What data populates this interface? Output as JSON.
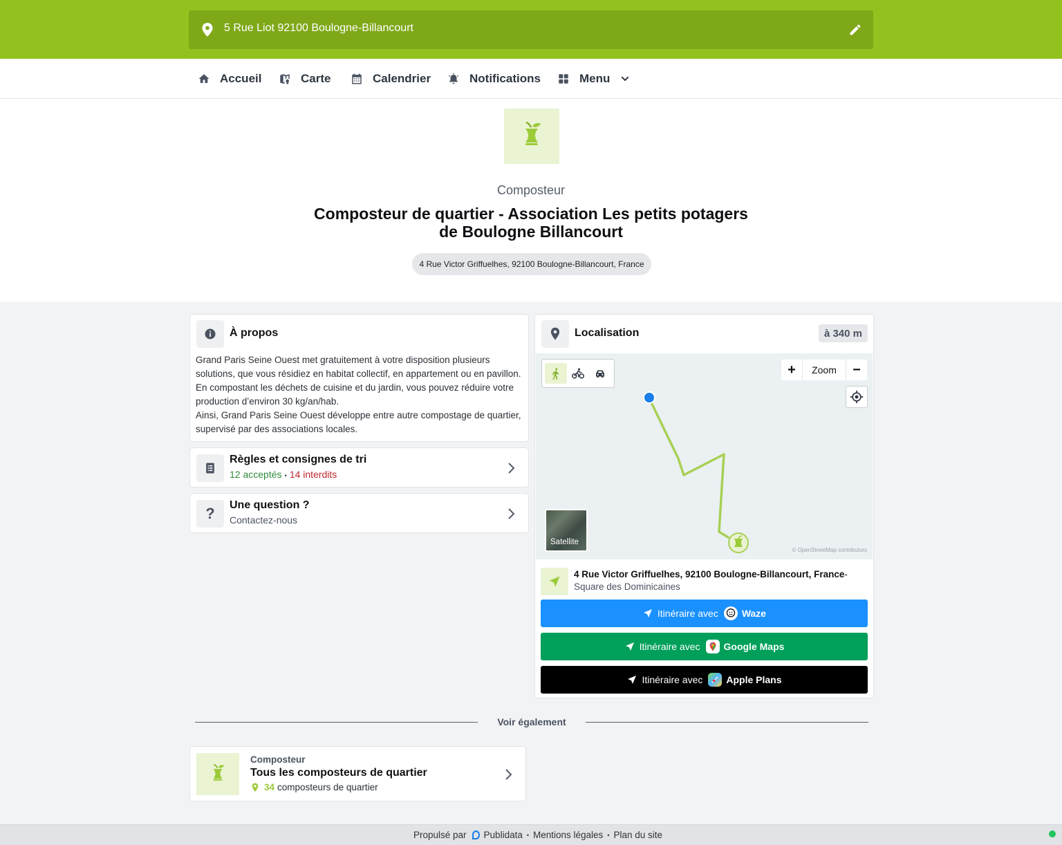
{
  "header": {
    "address": "5 Rue Liot 92100 Boulogne-Billancourt"
  },
  "nav": {
    "items": [
      {
        "label": "Accueil",
        "icon": "home-icon"
      },
      {
        "label": "Carte",
        "icon": "map-icon"
      },
      {
        "label": "Calendrier",
        "icon": "calendar-icon"
      },
      {
        "label": "Notifications",
        "icon": "bell-icon"
      },
      {
        "label": "Menu",
        "icon": "grid-icon"
      }
    ]
  },
  "hero": {
    "category": "Composteur",
    "title": "Composteur de quartier - Association Les petits potagers de Boulogne Billancourt",
    "address": "4 Rue Victor Griffuelhes, 92100 Boulogne-Billancourt, France"
  },
  "about": {
    "title": "À propos",
    "text_1": "Grand Paris Seine Ouest met gratuitement à votre disposition plusieurs solutions, que vous résidiez en habitat collectif, en appartement ou en pavillon. En compostant les déchets de cuisine et du jardin, vous pouvez réduire votre production d’environ 30 kg/an/hab.",
    "text_2": "Ainsi, Grand Paris Seine Ouest développe entre autre compostage de quartier, supervisé par des associations locales."
  },
  "rules": {
    "title": "Règles et consignes de tri",
    "accepted_count": "12",
    "accepted_label": "acceptés",
    "separator": "•",
    "forbidden_count": "14",
    "forbidden_label": "interdits"
  },
  "question": {
    "title": "Une question ?",
    "subtitle": "Contactez-nous"
  },
  "location": {
    "title": "Localisation",
    "distance": "à 340 m",
    "zoom_label": "Zoom",
    "zoom_in": "+",
    "zoom_out": "−",
    "satellite_label": "Satellite",
    "attribution": "© OpenStreetMap contributors",
    "dest_address": "4 Rue Victor Griffuelhes, 92100 Boulogne-Billancourt, France",
    "dest_suffix": "-",
    "dest_place": "Square des Dominicaines",
    "route_prefix": "Itinéraire avec",
    "routes": [
      {
        "app": "Waze",
        "color": "#1a91ff"
      },
      {
        "app": "Google Maps",
        "color": "#00a05a"
      },
      {
        "app": "Apple Plans",
        "color": "#000000"
      }
    ]
  },
  "see_also": {
    "heading": "Voir également",
    "card": {
      "category": "Composteur",
      "title": "Tous les composteurs de quartier",
      "count": "34",
      "count_label": "composteurs de quartier"
    }
  },
  "footer": {
    "powered_by": "Propulsé par",
    "brand": "Publidata",
    "sep": "•",
    "legal": "Mentions légales",
    "sitemap": "Plan du site"
  },
  "colors": {
    "brand_green": "#93c11f",
    "route_line": "#a8d056",
    "user_dot": "#1a7fe8"
  }
}
